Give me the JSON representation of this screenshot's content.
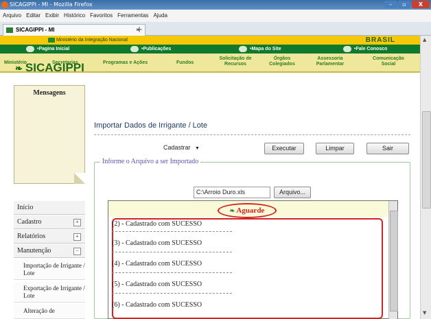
{
  "window": {
    "title": "SICAGIPPI - MI - Mozilla Firefox",
    "controls": [
      "–",
      "▫",
      "X"
    ]
  },
  "menubar": [
    "Arquivo",
    "Editar",
    "Exibir",
    "Histórico",
    "Favoritos",
    "Ferramentas",
    "Ajuda"
  ],
  "tab": {
    "label": "SICAGIPPI - MI",
    "close": "×",
    "new_tab": "+"
  },
  "gov_banner": {
    "ministry": "Ministério da Integração Nacional",
    "brand": "BRASIL",
    "top_links": [
      "•Pagina Inicial",
      "•Publicações",
      "•Mapa do Site",
      "•Fale Conosco"
    ],
    "nav": [
      "Ministério",
      "Secretarias",
      "Programas e Ações",
      "Fundos",
      "Solicitação de\nRecursos",
      "Órgãos\nColegiados",
      "Assessoria\nParlamentar",
      "Comunicação\nSocial"
    ]
  },
  "app": {
    "logo_mark": "❧",
    "logo": "SICAGIPPI"
  },
  "sidebar": {
    "messages_title": "Mensagens",
    "items": [
      {
        "label": "Início",
        "expander": ""
      },
      {
        "label": "Cadastro",
        "expander": "+"
      },
      {
        "label": "Relatórios",
        "expander": "+"
      },
      {
        "label": "Manutenção",
        "expander": "−"
      }
    ],
    "subitems": [
      "Importação de Irrigante / Lote",
      "Exportação de Irrigante / Lote",
      "Alteração de"
    ]
  },
  "main": {
    "title": "Importar Dados de Irrigante / Lote",
    "action_select": "Cadastrar",
    "buttons": {
      "execute": "Executar",
      "clear": "Limpar",
      "exit": "Sair"
    },
    "fieldset_legend": "Informe o Arquivo a ser Importado",
    "file_value": "C:\\Arroio Duro.xls",
    "file_button": "Arquivo...",
    "status": "Aguarde",
    "results": [
      "(2) - Cadastrado com SUCESSO",
      "(3) - Cadastrado com SUCESSO",
      "(4) - Cadastrado com SUCESSO",
      "(5) - Cadastrado com SUCESSO",
      "(6) - Cadastrado com SUCESSO"
    ]
  }
}
